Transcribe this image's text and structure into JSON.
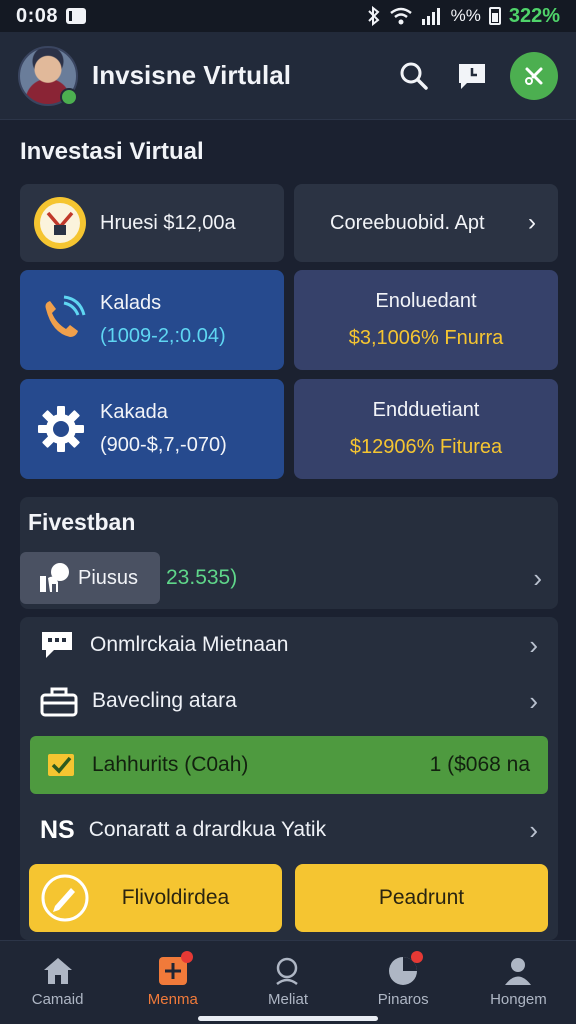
{
  "status_bar": {
    "time": "0:08",
    "signal_text": "%%",
    "battery": "322%"
  },
  "header": {
    "app_title": "Invsisne Virtulal"
  },
  "section1": {
    "title": "Investasi Virtual"
  },
  "cards": {
    "card1": {
      "label": "Hruesi $12,00a"
    },
    "card2": {
      "label": "Coreebuobid. Apt"
    },
    "card3": {
      "title": "Kalads",
      "value": "(1009-2,:0.04)"
    },
    "card4": {
      "title": "Enoluedant",
      "value": "$3,1006% Fnurra"
    },
    "card5": {
      "title": "Kakada",
      "value": "(900-$,7,-070)"
    },
    "card6": {
      "title": "Endduetiant",
      "value": "$12906% Fiturea"
    }
  },
  "section2": {
    "title": "Fivestban",
    "pill_label": "Piusus",
    "pill_value": "23.535)"
  },
  "list": {
    "row1": "Onmlrckaia Mietnaan",
    "row2": "Bavecling atara",
    "green_label": "Lahhurits (C0ah)",
    "green_value": "1 ($068 na",
    "row4_prefix": "NS",
    "row4": "Conaratt a drardkua Yatik"
  },
  "buttons": {
    "left": "Flivoldirdea",
    "right": "Peadrunt"
  },
  "bottom_nav": [
    {
      "label": "Camaid"
    },
    {
      "label": "Menma"
    },
    {
      "label": "Meliat"
    },
    {
      "label": "Pinaros"
    },
    {
      "label": "Hongem"
    }
  ],
  "colors": {
    "accent_green": "#4caf50",
    "accent_yellow": "#f5c531",
    "accent_orange": "#f07a3a",
    "card_blue": "#264a8e"
  }
}
